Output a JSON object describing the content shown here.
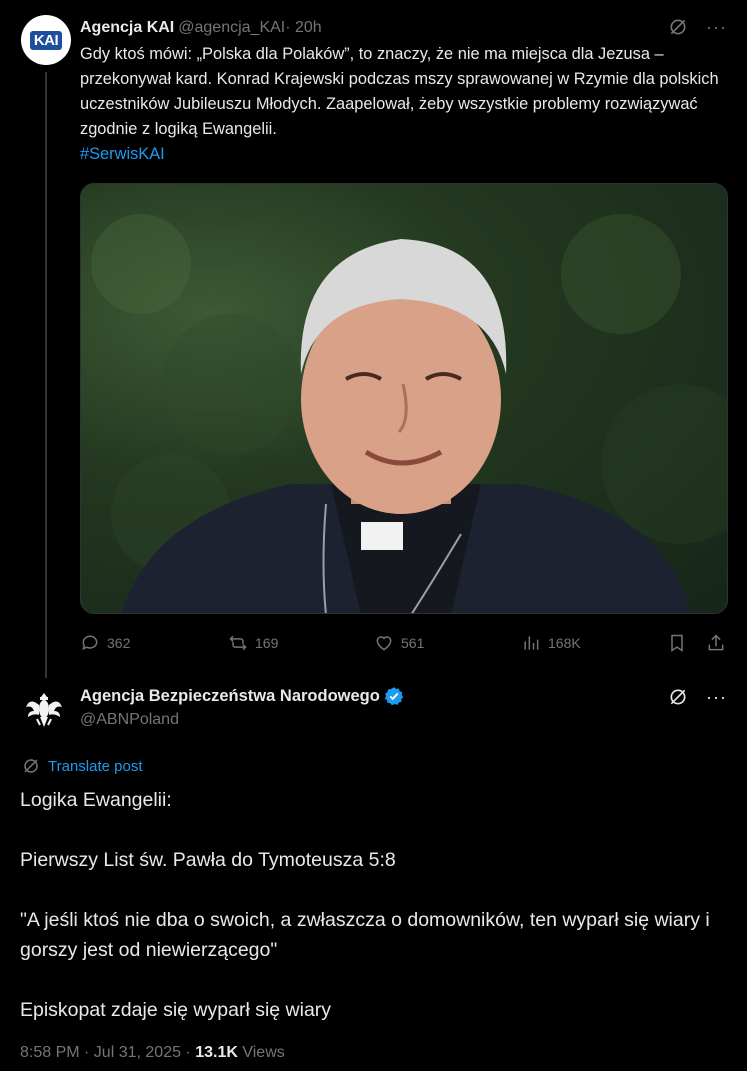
{
  "parent_tweet": {
    "author_name": "Agencja KAI",
    "handle": "@agencja_KAI",
    "time": " · 20h",
    "avatar_text": "KAI",
    "text": "Gdy ktoś mówi: „Polska dla Polaków”, to znaczy, że nie ma miejsca dla Jezusa – przekonywał kard. Konrad Krajewski podczas mszy sprawowanej w Rzymie dla polskich uczestników Jubileuszu Młodych. Zaapelował, żeby wszystkie problemy rozwiązywać zgodnie z logiką Ewangelii.",
    "hashtag": "#SerwisKAI",
    "stats": {
      "replies": "362",
      "reposts": "169",
      "likes": "561",
      "views": "168K"
    }
  },
  "main_tweet": {
    "author_name": "Agencja Bezpieczeństwa Narodowego",
    "handle": "@ABNPoland",
    "translate_label": "Translate post",
    "text": "Logika Ewangelii:\n\nPierwszy List św. Pawła do Tymoteusza 5:8\n\n\"A jeśli ktoś nie dba o swoich, a zwłaszcza o domowników, ten wyparł się wiary i gorszy jest od niewierzącego\"\n\nEpiskopat zdaje się wyparł się wiary",
    "timestamp": "8:58 PM · Jul 31, 2025 · ",
    "views_count": "13.1K",
    "views_label": " Views"
  },
  "colors": {
    "background": "#000000",
    "text": "#e7e9ea",
    "muted": "#71767b",
    "accent": "#1d9bf0"
  }
}
